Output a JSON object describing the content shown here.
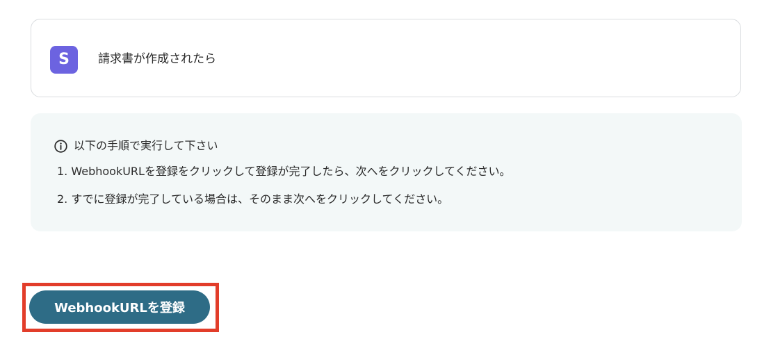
{
  "trigger": {
    "app_letter": "S",
    "label": "請求書が作成されたら",
    "icon": "app-logo-s",
    "icon_color": "#6c63e0"
  },
  "instructions": {
    "icon": "info-circle-icon",
    "title": "以下の手順で実行して下さい",
    "steps": [
      "1. WebhookURLを登録をクリックして登録が完了したら、次へをクリックしてください。",
      "2. すでに登録が完了している場合は、そのまま次へをクリックしてください。"
    ],
    "background": "#f3f8f8"
  },
  "action": {
    "register_label": "WebhookURLを登録",
    "button_color": "#2e6c86",
    "highlight_color": "#e23d2a"
  }
}
